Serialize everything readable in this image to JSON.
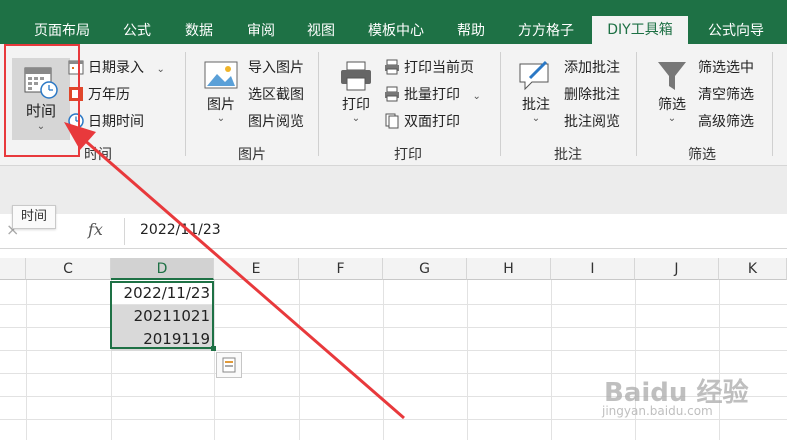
{
  "tabs": [
    {
      "label": "页面布局"
    },
    {
      "label": "公式"
    },
    {
      "label": "数据"
    },
    {
      "label": "审阅"
    },
    {
      "label": "视图"
    },
    {
      "label": "模板中心"
    },
    {
      "label": "帮助"
    },
    {
      "label": "方方格子"
    },
    {
      "label": "DIY工具箱"
    },
    {
      "label": "公式向导"
    }
  ],
  "active_tab": "DIY工具箱",
  "ribbon": {
    "time_group": {
      "big_button": "时间",
      "items": [
        "日期录入",
        "万年历",
        "日期时间"
      ],
      "label": "时间"
    },
    "picture_group": {
      "big_button": "图片",
      "items": [
        "导入图片",
        "选区截图",
        "图片阅览"
      ],
      "label": "图片"
    },
    "print_group": {
      "big_button": "打印",
      "items": [
        "打印当前页",
        "批量打印",
        "双面打印"
      ],
      "label": "打印"
    },
    "comment_group": {
      "big_button": "批注",
      "items": [
        "添加批注",
        "删除批注",
        "批注阅览"
      ],
      "label": "批注"
    },
    "filter_group": {
      "big_button": "筛选",
      "items": [
        "筛选选中",
        "清空筛选",
        "高级筛选"
      ],
      "label": "筛选"
    }
  },
  "tooltip": "时间",
  "formula_bar": {
    "fx": "fx",
    "content": "2022/11/23"
  },
  "columns": [
    "C",
    "D",
    "E",
    "F",
    "G",
    "H",
    "I",
    "J",
    "K"
  ],
  "selected_column": "D",
  "cells": [
    "2022/11/23",
    "20211021",
    "2019119"
  ],
  "watermark": {
    "main": "Baidu 经验",
    "sub": "jingyan.baidu.com"
  },
  "colors": {
    "ribbon_green": "#1e7145",
    "highlight_red": "#e8393c"
  }
}
